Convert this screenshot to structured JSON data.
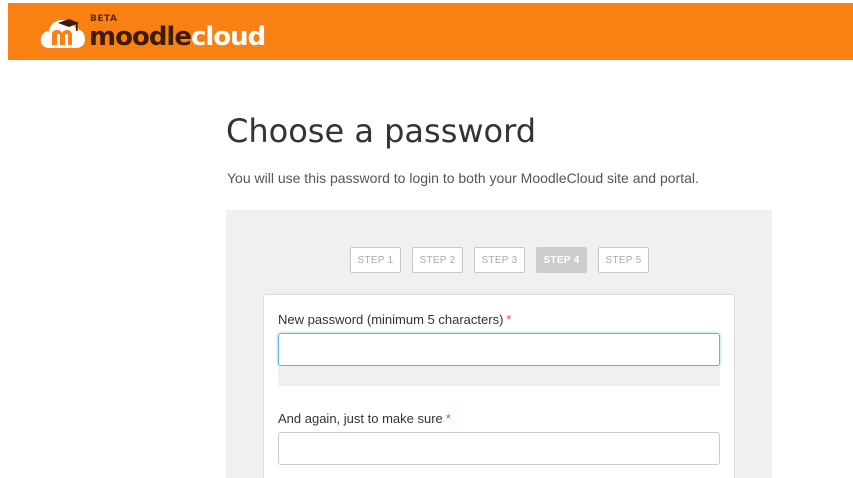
{
  "header": {
    "brand_color": "#f98012",
    "logo": {
      "badge": "BETA",
      "word_primary": "moodle",
      "word_secondary": "cloud",
      "icon": "moodle-cloud-logo-icon"
    }
  },
  "main": {
    "title": "Choose a password",
    "subtitle": "You will use this password to login to both your MoodleCloud site and portal."
  },
  "steps": {
    "items": [
      {
        "label": "STEP 1",
        "active": false
      },
      {
        "label": "STEP 2",
        "active": false
      },
      {
        "label": "STEP 3",
        "active": false
      },
      {
        "label": "STEP 4",
        "active": true
      },
      {
        "label": "STEP 5",
        "active": false
      }
    ]
  },
  "form": {
    "password": {
      "label": "New password (minimum 5 characters)",
      "required_marker": "*",
      "value": "",
      "placeholder": ""
    },
    "password_confirm": {
      "label": "And again, just to make sure",
      "required_marker": "*",
      "value": "",
      "placeholder": ""
    }
  }
}
